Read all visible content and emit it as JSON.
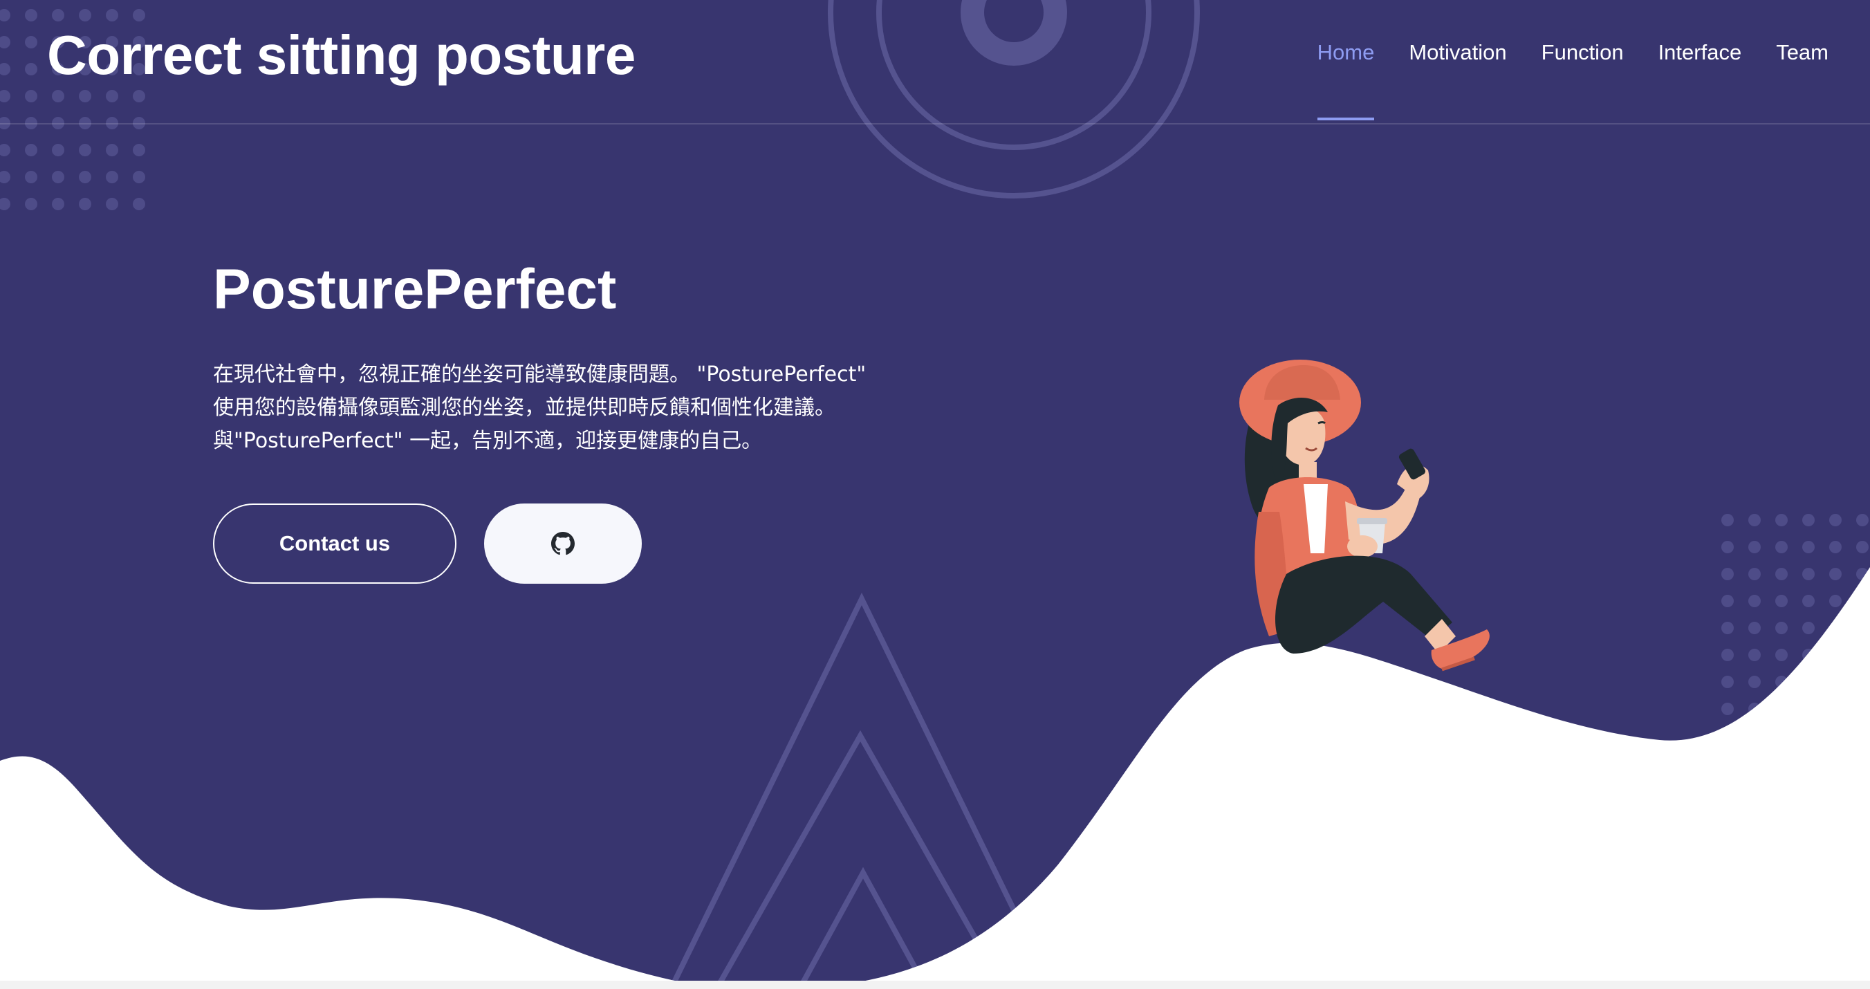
{
  "header": {
    "site_title": "Correct sitting posture",
    "nav": [
      {
        "label": "Home",
        "active": true
      },
      {
        "label": "Motivation",
        "active": false
      },
      {
        "label": "Function",
        "active": false
      },
      {
        "label": "Interface",
        "active": false
      },
      {
        "label": "Team",
        "active": false
      }
    ]
  },
  "hero": {
    "title": "PosturePerfect",
    "description_lines": [
      "在現代社會中，忽視正確的坐姿可能導致健康問題。 \"PosturePerfect\"",
      "使用您的設備攝像頭監測您的坐姿，並提供即時反饋和個性化建議。",
      "與\"PosturePerfect\" 一起，告別不適，迎接更健康的自己。"
    ],
    "contact_button": "Contact us",
    "github_button_icon": "github-icon"
  },
  "colors": {
    "background": "#38356f",
    "accent": "#8e9cf2",
    "wave": "#ffffff",
    "decor": "#5a5892"
  },
  "icons": {
    "illustration": "woman-sitting-with-phone-and-coffee"
  }
}
